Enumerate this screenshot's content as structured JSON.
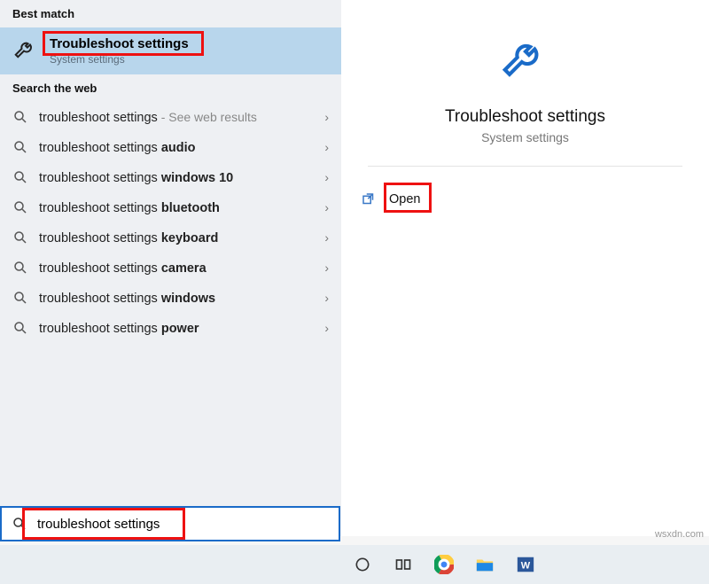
{
  "sections": {
    "best_match_header": "Best match",
    "search_web_header": "Search the web"
  },
  "best_match": {
    "title": "Troubleshoot settings",
    "subtitle": "System settings"
  },
  "web_results": [
    {
      "prefix": "troubleshoot settings",
      "suffix": "",
      "hint": " - See web results"
    },
    {
      "prefix": "troubleshoot settings ",
      "suffix": "audio",
      "hint": ""
    },
    {
      "prefix": "troubleshoot settings ",
      "suffix": "windows 10",
      "hint": ""
    },
    {
      "prefix": "troubleshoot settings ",
      "suffix": "bluetooth",
      "hint": ""
    },
    {
      "prefix": "troubleshoot settings ",
      "suffix": "keyboard",
      "hint": ""
    },
    {
      "prefix": "troubleshoot settings ",
      "suffix": "camera",
      "hint": ""
    },
    {
      "prefix": "troubleshoot settings ",
      "suffix": "windows",
      "hint": ""
    },
    {
      "prefix": "troubleshoot settings ",
      "suffix": "power",
      "hint": ""
    }
  ],
  "preview": {
    "title": "Troubleshoot settings",
    "subtitle": "System settings",
    "open_label": "Open"
  },
  "search": {
    "value": "troubleshoot settings"
  },
  "watermark": "wsxdn.com"
}
